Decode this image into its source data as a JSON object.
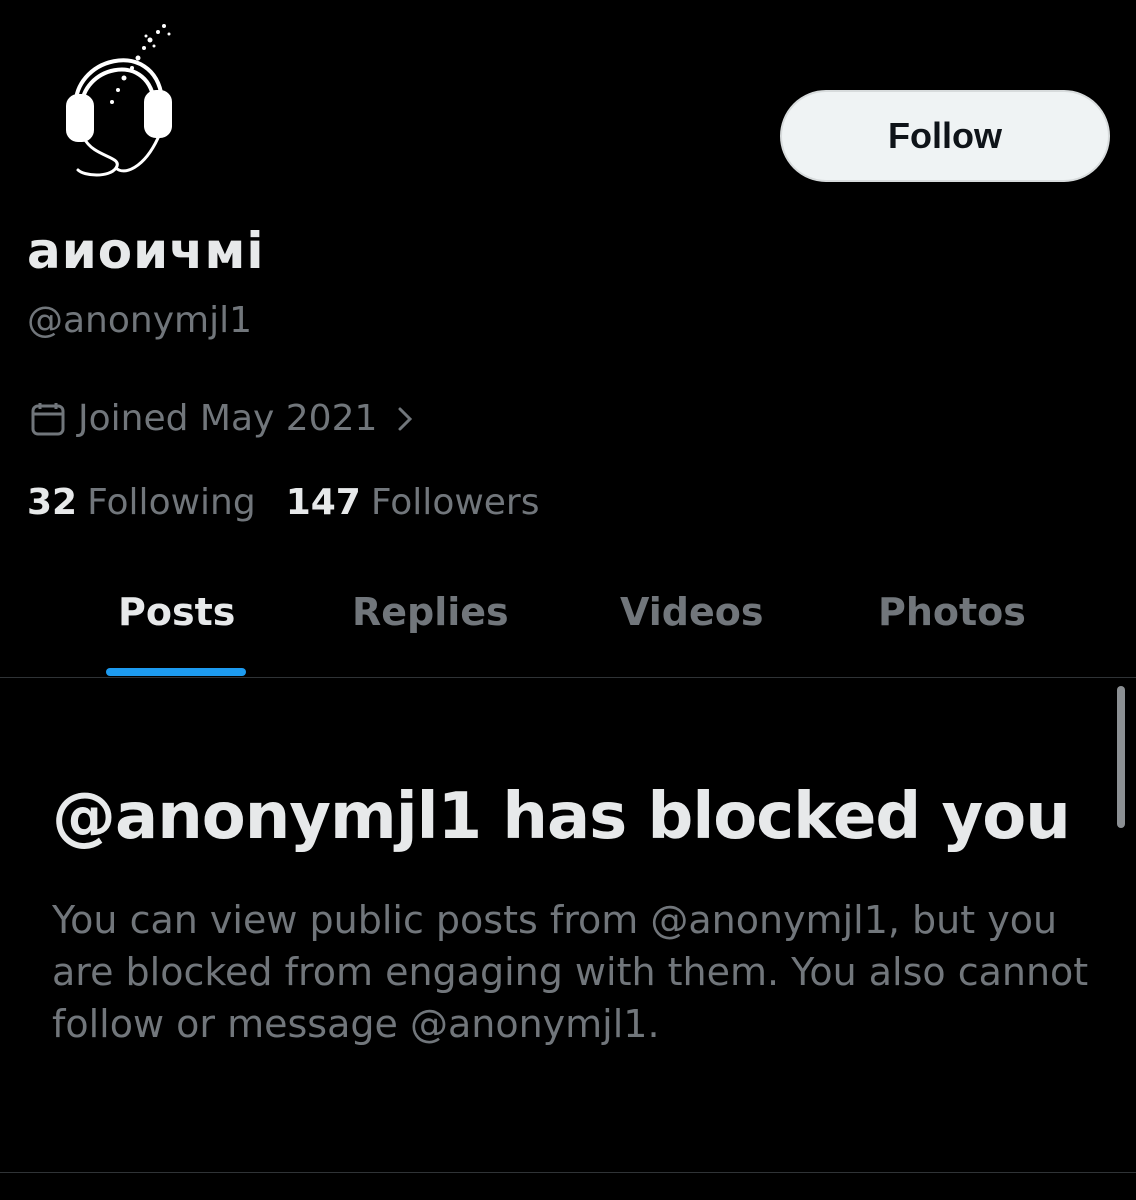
{
  "profile": {
    "display_name": "аиоичмі",
    "handle": "@anonymjl1",
    "joined": "Joined May 2021",
    "avatar_icon": "headphones-avatar"
  },
  "actions": {
    "follow_label": "Follow"
  },
  "stats": {
    "following_count": "32",
    "following_label": "Following",
    "followers_count": "147",
    "followers_label": "Followers"
  },
  "tabs": [
    {
      "label": "Posts",
      "active": true
    },
    {
      "label": "Replies",
      "active": false
    },
    {
      "label": "Videos",
      "active": false
    },
    {
      "label": "Photos",
      "active": false
    }
  ],
  "blocked": {
    "title": "@anonymjl1 has blocked you",
    "body": "You can view public posts from @anonymjl1, but you are blocked from engaging with them. You also cannot follow or message @anonymjl1."
  },
  "colors": {
    "background": "#000000",
    "text_primary": "#e7e9ea",
    "text_secondary": "#71767b",
    "accent": "#1d9bf0",
    "button_bg": "#eff3f4"
  }
}
